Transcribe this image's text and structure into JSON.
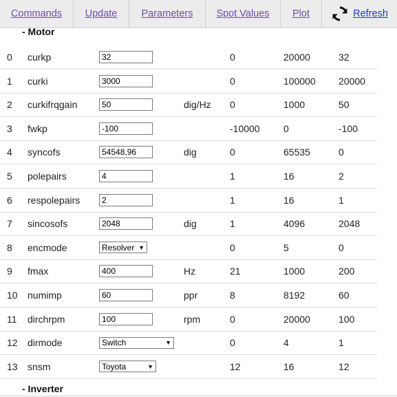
{
  "nav": {
    "commands": "Commands",
    "update": "Update",
    "parameters": "Parameters",
    "spot_values": "Spot Values",
    "plot": "Plot",
    "refresh": "Refresh"
  },
  "sections": {
    "motor": "- Motor",
    "inverter": "- Inverter"
  },
  "rows": [
    {
      "idx": "0",
      "name": "curkp",
      "value": "32",
      "unit": "",
      "min": "0",
      "max": "20000",
      "def": "32"
    },
    {
      "idx": "1",
      "name": "curki",
      "value": "3000",
      "unit": "",
      "min": "0",
      "max": "100000",
      "def": "20000"
    },
    {
      "idx": "2",
      "name": "curkifrqgain",
      "value": "50",
      "unit": "dig/Hz",
      "min": "0",
      "max": "1000",
      "def": "50"
    },
    {
      "idx": "3",
      "name": "fwkp",
      "value": "-100",
      "unit": "",
      "min": "-10000",
      "max": "0",
      "def": "-100"
    },
    {
      "idx": "4",
      "name": "syncofs",
      "value": "54548,96",
      "unit": "dig",
      "min": "0",
      "max": "65535",
      "def": "0"
    },
    {
      "idx": "5",
      "name": "polepairs",
      "value": "4",
      "unit": "",
      "min": "1",
      "max": "16",
      "def": "2"
    },
    {
      "idx": "6",
      "name": "respolepairs",
      "value": "2",
      "unit": "",
      "min": "1",
      "max": "16",
      "def": "1"
    },
    {
      "idx": "7",
      "name": "sincosofs",
      "value": "2048",
      "unit": "dig",
      "min": "1",
      "max": "4096",
      "def": "2048"
    },
    {
      "idx": "8",
      "name": "encmode",
      "value": "Resolver",
      "unit": "",
      "min": "0",
      "max": "5",
      "def": "0"
    },
    {
      "idx": "9",
      "name": "fmax",
      "value": "400",
      "unit": "Hz",
      "min": "21",
      "max": "1000",
      "def": "200"
    },
    {
      "idx": "10",
      "name": "numimp",
      "value": "60",
      "unit": "ppr",
      "min": "8",
      "max": "8192",
      "def": "60"
    },
    {
      "idx": "11",
      "name": "dirchrpm",
      "value": "100",
      "unit": "rpm",
      "min": "0",
      "max": "20000",
      "def": "100"
    },
    {
      "idx": "12",
      "name": "dirmode",
      "value": "Switch",
      "unit": "",
      "min": "0",
      "max": "4",
      "def": "1"
    },
    {
      "idx": "13",
      "name": "snsm",
      "value": "Toyota",
      "unit": "",
      "min": "12",
      "max": "16",
      "def": "12"
    }
  ]
}
